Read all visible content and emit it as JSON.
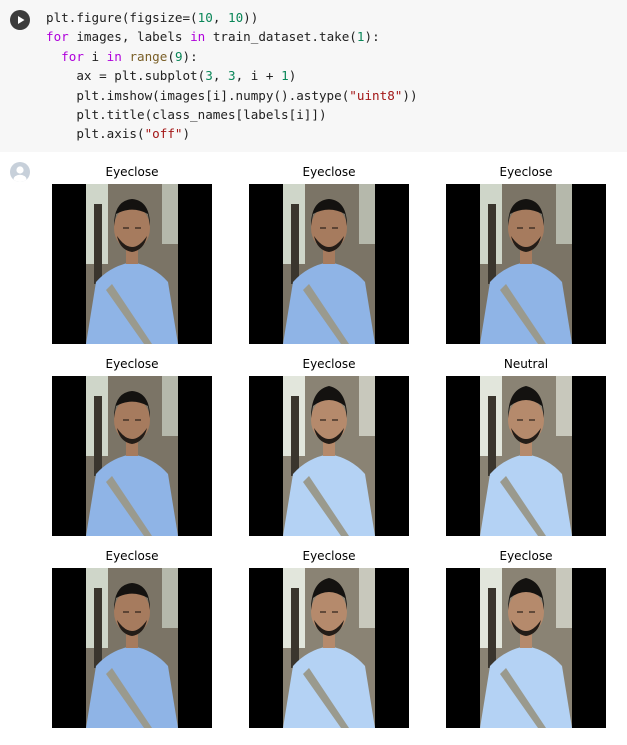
{
  "code_cell": {
    "run_button": "play-icon",
    "lines": [
      [
        {
          "t": "plain",
          "s": "plt.figure(figsize=("
        },
        {
          "t": "num",
          "s": "10"
        },
        {
          "t": "plain",
          "s": ", "
        },
        {
          "t": "num",
          "s": "10"
        },
        {
          "t": "plain",
          "s": "))"
        }
      ],
      [
        {
          "t": "kw",
          "s": "for"
        },
        {
          "t": "plain",
          "s": " images, labels "
        },
        {
          "t": "kw",
          "s": "in"
        },
        {
          "t": "plain",
          "s": " train_dataset.take("
        },
        {
          "t": "num",
          "s": "1"
        },
        {
          "t": "plain",
          "s": "):"
        }
      ],
      [
        {
          "t": "plain",
          "s": "  "
        },
        {
          "t": "kw",
          "s": "for"
        },
        {
          "t": "plain",
          "s": " i "
        },
        {
          "t": "kw",
          "s": "in"
        },
        {
          "t": "plain",
          "s": " "
        },
        {
          "t": "fn",
          "s": "range"
        },
        {
          "t": "plain",
          "s": "("
        },
        {
          "t": "num",
          "s": "9"
        },
        {
          "t": "plain",
          "s": "):"
        }
      ],
      [
        {
          "t": "plain",
          "s": "    ax = plt.subplot("
        },
        {
          "t": "num",
          "s": "3"
        },
        {
          "t": "plain",
          "s": ", "
        },
        {
          "t": "num",
          "s": "3"
        },
        {
          "t": "plain",
          "s": ", i + "
        },
        {
          "t": "num",
          "s": "1"
        },
        {
          "t": "plain",
          "s": ")"
        }
      ],
      [
        {
          "t": "plain",
          "s": "    plt.imshow(images[i].numpy().astype("
        },
        {
          "t": "str",
          "s": "\"uint8\""
        },
        {
          "t": "plain",
          "s": "))"
        }
      ],
      [
        {
          "t": "plain",
          "s": "    plt.title(class_names[labels[i]])"
        }
      ],
      [
        {
          "t": "plain",
          "s": "    plt.axis("
        },
        {
          "t": "str",
          "s": "\"off\""
        },
        {
          "t": "plain",
          "s": ")"
        }
      ]
    ]
  },
  "output": {
    "avatar": "output-avatar-icon",
    "panels": [
      {
        "title": "Eyeclose",
        "style": "A"
      },
      {
        "title": "Eyeclose",
        "style": "A"
      },
      {
        "title": "Eyeclose",
        "style": "A"
      },
      {
        "title": "Eyeclose",
        "style": "A"
      },
      {
        "title": "Eyeclose",
        "style": "B"
      },
      {
        "title": "Neutral",
        "style": "B"
      },
      {
        "title": "Eyeclose",
        "style": "A"
      },
      {
        "title": "Eyeclose",
        "style": "B"
      },
      {
        "title": "Eyeclose",
        "style": "B"
      }
    ]
  }
}
